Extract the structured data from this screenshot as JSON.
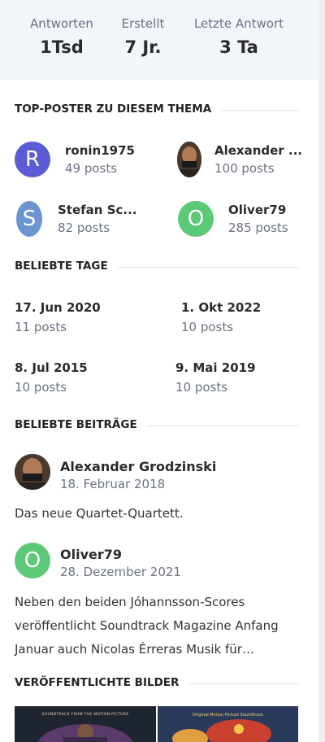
{
  "stats": [
    {
      "label": "Antworten",
      "value": "1Tsd"
    },
    {
      "label": "Erstellt",
      "value": "7 Jr."
    },
    {
      "label": "Letzte Antwort",
      "value": "3 Ta"
    }
  ],
  "top_posters": {
    "title": "TOP-POSTER ZU DIESEM THEMA",
    "items": [
      {
        "name": "ronin1975",
        "count": "49 posts",
        "initial": "R",
        "color": "#5b5bd6"
      },
      {
        "name": "Alexander ...",
        "count": "100 posts"
      },
      {
        "name": "Stefan Sc...",
        "count": "82 posts",
        "initial": "S",
        "color": "#6c94d1"
      },
      {
        "name": "Oliver79",
        "count": "285 posts",
        "initial": "O",
        "color": "#5cc977"
      }
    ]
  },
  "popular_days": {
    "title": "BELIEBTE TAGE",
    "items": [
      {
        "date": "17. Jun 2020",
        "count": "11 posts"
      },
      {
        "date": "1. Okt 2022",
        "count": "10 posts"
      },
      {
        "date": "8. Jul 2015",
        "count": "10 posts"
      },
      {
        "date": "9. Mai 2019",
        "count": "10 posts"
      }
    ]
  },
  "popular_posts": {
    "title": "BELIEBTE BEITRÄGE",
    "items": [
      {
        "author": "Alexander Grodzinski",
        "date": "18. Februar 2018",
        "text": "Das neue Quartet-Quartett."
      },
      {
        "author": "Oliver79",
        "date": "28. Dezember 2021",
        "initial": "O",
        "color": "#5cc977",
        "text": "Neben den beiden Jóhannsson-Scores veröffentlicht Soundtrack Magazine Anfang Januar auch Nicolas Érreras Musik für…"
      }
    ]
  },
  "images": {
    "title": "VERÖFFENTLICHTE BILDER",
    "thumbs": [
      {
        "caption": "SOUNDTRACK FROM THE MOTION PICTURE"
      },
      {
        "caption": "Original Motion Picture Soundtrack"
      }
    ]
  }
}
